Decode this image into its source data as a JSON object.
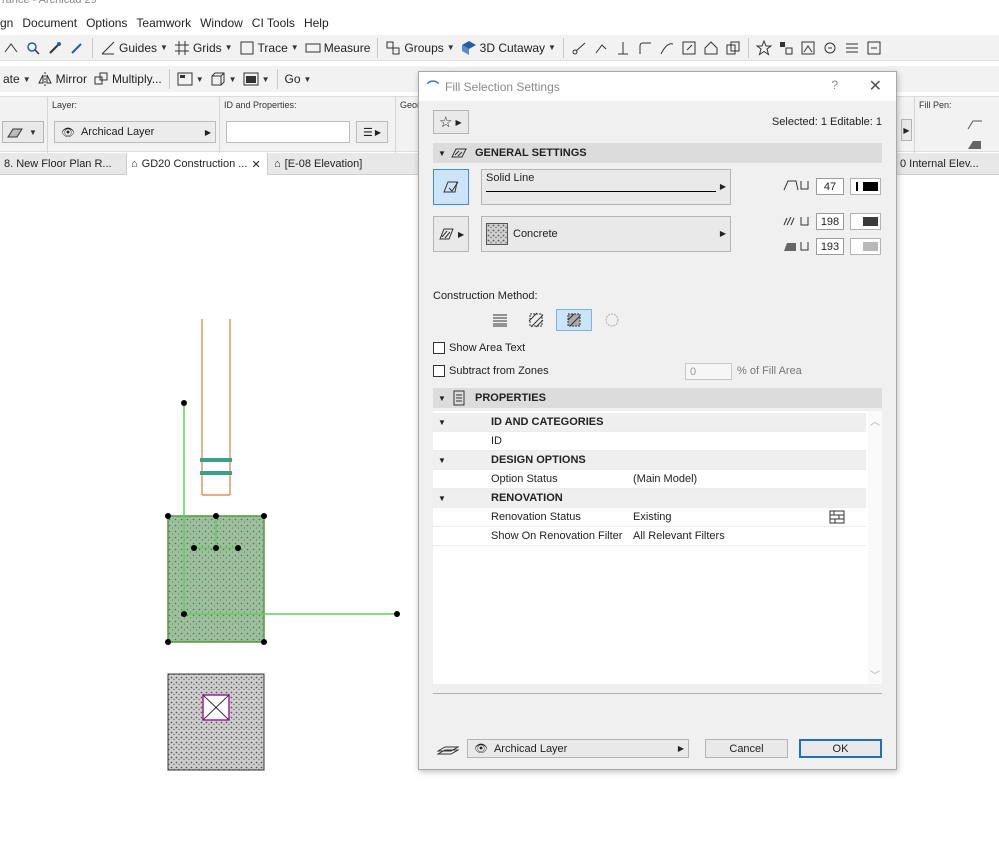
{
  "app": {
    "window_title": "rance - Archicad 29"
  },
  "menu": [
    "gn",
    "Document",
    "Options",
    "Teamwork",
    "Window",
    "CI Tools",
    "Help"
  ],
  "toolbar1": {
    "guides_label": "Guides",
    "grids_label": "Grids",
    "trace_label": "Trace",
    "measure_label": "Measure",
    "groups_label": "Groups",
    "cutaway_label": "3D Cutaway"
  },
  "toolbar2": {
    "rotate_label": "ate",
    "mirror_label": "Mirror",
    "multiply_label": "Multiply...",
    "go_label": "Go"
  },
  "infobox": {
    "layer_label": "Layer:",
    "layer_value": "Archicad Layer",
    "id_label": "ID and Properties:",
    "id_value": "",
    "geom_label": "Geom",
    "fill_pen_label": "Fill Pen:"
  },
  "tabs": [
    {
      "label": "8. New Floor Plan R..."
    },
    {
      "label": "GD20 Construction ..."
    },
    {
      "label": "[E-08 Elevation]"
    },
    {
      "label": "0 Internal Elev..."
    }
  ],
  "dialog": {
    "title": "Fill Selection Settings",
    "help": "?",
    "selected_info": "Selected: 1 Editable: 1",
    "general_settings": "GENERAL SETTINGS",
    "line_type": "Solid Line",
    "fill_type": "Concrete",
    "contour_pen": "47",
    "fill_pen": "198",
    "background_pen": "193",
    "construction_method_label": "Construction Method:",
    "show_area_text": "Show Area Text",
    "subtract_from_zones": "Subtract from Zones",
    "fill_area_percent": "0",
    "fill_area_unit": "% of Fill Area",
    "properties_label": "PROPERTIES",
    "properties": [
      {
        "group": "ID AND CATEGORIES"
      },
      {
        "label": "ID",
        "value": ""
      },
      {
        "group": "DESIGN OPTIONS"
      },
      {
        "label": "Option Status",
        "value": "(Main Model)"
      },
      {
        "group": "RENOVATION"
      },
      {
        "label": "Renovation Status",
        "value": "Existing"
      },
      {
        "label": "Show On Renovation Filter",
        "value": "All Relevant Filters"
      }
    ],
    "layer_value": "Archicad Layer",
    "cancel_label": "Cancel",
    "ok_label": "OK"
  },
  "colors": {
    "accent": "#1f6fbf",
    "fill_green": "#9cbf9c",
    "selection_line": "#5fcf5f",
    "wall_orange": "#e07a3c",
    "pen_47": "#000000",
    "pen_198": "#3a3a3a",
    "pen_193": "#b8b8b8"
  }
}
